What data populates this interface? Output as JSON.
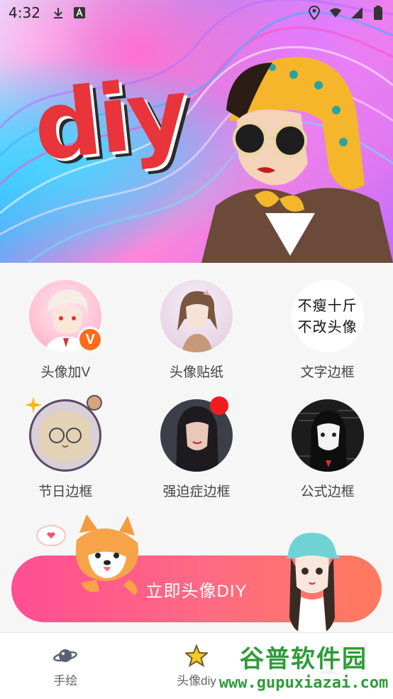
{
  "status_bar": {
    "time": "4:32",
    "left_icons": [
      "download-icon",
      "a-icon"
    ],
    "right_icons": [
      "location-icon",
      "wifi-icon",
      "signal-icon",
      "battery-icon"
    ]
  },
  "hero": {
    "title": "diy"
  },
  "options": [
    {
      "label": "头像加V",
      "badge": "V"
    },
    {
      "label": "头像贴纸"
    },
    {
      "label": "文字边框",
      "thumb_lines": [
        "不瘦十斤",
        "不改头像"
      ]
    },
    {
      "label": "节日边框"
    },
    {
      "label": "强迫症边框"
    },
    {
      "label": "公式边框"
    }
  ],
  "cta": {
    "label": "立即头像DIY"
  },
  "bottom_nav": [
    {
      "label": "手绘",
      "icon": "planet-icon"
    },
    {
      "label": "头像diy",
      "icon": "star-icon"
    },
    {
      "label": "",
      "icon": "profile-icon"
    }
  ],
  "watermark": {
    "cn": "谷普软件园",
    "url": "www.gupuxiazai.com"
  },
  "colors": {
    "cta_start": "#ff4e93",
    "cta_end": "#ff7a5e",
    "badge": "#ff6b1a",
    "red_dot": "#f21c1c",
    "diy_red": "#e8343a"
  }
}
